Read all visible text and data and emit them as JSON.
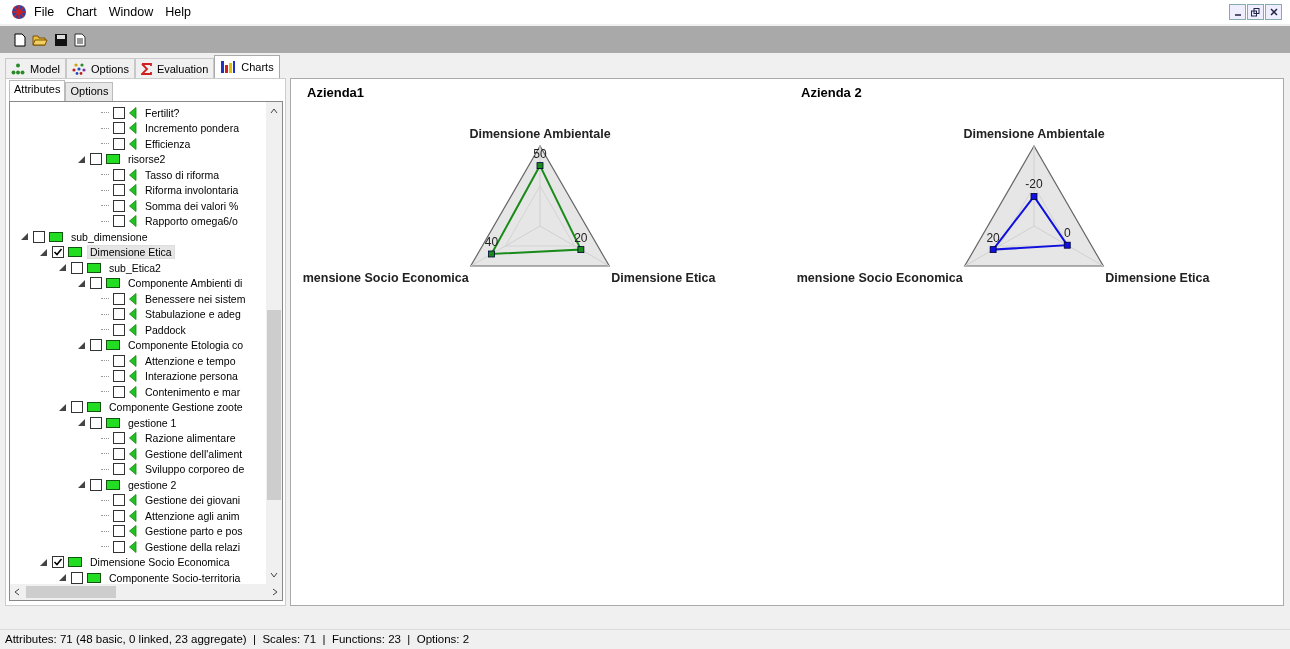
{
  "menu": [
    "File",
    "Chart",
    "Window",
    "Help"
  ],
  "tabs": [
    {
      "label": "Model",
      "selected": false
    },
    {
      "label": "Options",
      "selected": false
    },
    {
      "label": "Evaluation",
      "selected": false
    },
    {
      "label": "Charts",
      "selected": true
    }
  ],
  "subtabs": [
    {
      "label": "Attributes",
      "selected": true
    },
    {
      "label": "Options",
      "selected": false
    }
  ],
  "tree": [
    {
      "children": [
        {
          "children": [
            {
              "children": [
                {
                  "children": [
                    {
                      "label": "Fertilit?",
                      "kind": "basic",
                      "checked": false,
                      "selected": false
                    },
                    {
                      "label": "Incremento pondera",
                      "kind": "basic",
                      "checked": false,
                      "selected": false
                    },
                    {
                      "label": "Efficienza",
                      "kind": "basic",
                      "checked": false,
                      "selected": false
                    }
                  ]
                },
                {
                  "label": "risorse2",
                  "kind": "aggregate",
                  "checked": false,
                  "selected": false,
                  "expanded": true,
                  "children": [
                    {
                      "label": "Tasso di riforma",
                      "kind": "basic",
                      "checked": false,
                      "selected": false
                    },
                    {
                      "label": "Riforma involontaria",
                      "kind": "basic",
                      "checked": false,
                      "selected": false
                    },
                    {
                      "label": "Somma dei valori %",
                      "kind": "basic",
                      "checked": false,
                      "selected": false
                    },
                    {
                      "label": "Rapporto omega6/o",
                      "kind": "basic",
                      "checked": false,
                      "selected": false
                    }
                  ]
                }
              ]
            }
          ]
        }
      ]
    },
    {
      "label": "sub_dimensione",
      "kind": "aggregate",
      "checked": false,
      "selected": false,
      "expanded": true,
      "children": [
        {
          "label": "Dimensione Etica",
          "kind": "aggregate",
          "checked": true,
          "selected": true,
          "expanded": true,
          "children": [
            {
              "label": "sub_Etica2",
              "kind": "aggregate",
              "checked": false,
              "selected": false,
              "expanded": true,
              "children": [
                {
                  "label": "Componente Ambienti di",
                  "kind": "aggregate",
                  "checked": false,
                  "selected": false,
                  "expanded": true,
                  "children": [
                    {
                      "label": "Benessere nei sistem",
                      "kind": "basic",
                      "checked": false,
                      "selected": false
                    },
                    {
                      "label": "Stabulazione e adeg",
                      "kind": "basic",
                      "checked": false,
                      "selected": false
                    },
                    {
                      "label": "Paddock",
                      "kind": "basic",
                      "checked": false,
                      "selected": false
                    }
                  ]
                },
                {
                  "label": "Componente Etologia co",
                  "kind": "aggregate",
                  "checked": false,
                  "selected": false,
                  "expanded": true,
                  "children": [
                    {
                      "label": "Attenzione e tempo",
                      "kind": "basic",
                      "checked": false,
                      "selected": false
                    },
                    {
                      "label": "Interazione persona",
                      "kind": "basic",
                      "checked": false,
                      "selected": false
                    },
                    {
                      "label": "Contenimento e mar",
                      "kind": "basic",
                      "checked": false,
                      "selected": false
                    }
                  ]
                }
              ]
            },
            {
              "label": "Componente Gestione zoote",
              "kind": "aggregate",
              "checked": false,
              "selected": false,
              "expanded": true,
              "children": [
                {
                  "label": "gestione 1",
                  "kind": "aggregate",
                  "checked": false,
                  "selected": false,
                  "expanded": true,
                  "children": [
                    {
                      "label": "Razione alimentare",
                      "kind": "basic",
                      "checked": false,
                      "selected": false
                    },
                    {
                      "label": "Gestione dell'aliment",
                      "kind": "basic",
                      "checked": false,
                      "selected": false
                    },
                    {
                      "label": "Sviluppo corporeo de",
                      "kind": "basic",
                      "checked": false,
                      "selected": false
                    }
                  ]
                },
                {
                  "label": "gestione 2",
                  "kind": "aggregate",
                  "checked": false,
                  "selected": false,
                  "expanded": true,
                  "children": [
                    {
                      "label": "Gestione dei giovani",
                      "kind": "basic",
                      "checked": false,
                      "selected": false
                    },
                    {
                      "label": "Attenzione agli anim",
                      "kind": "basic",
                      "checked": false,
                      "selected": false
                    },
                    {
                      "label": "Gestione parto e pos",
                      "kind": "basic",
                      "checked": false,
                      "selected": false
                    },
                    {
                      "label": "Gestione della relazi",
                      "kind": "basic",
                      "checked": false,
                      "selected": false
                    }
                  ]
                }
              ]
            }
          ]
        },
        {
          "label": "Dimensione Socio Economica",
          "kind": "aggregate",
          "checked": true,
          "selected": false,
          "expanded": true,
          "children": [
            {
              "label": "Componente Socio-territoria",
              "kind": "aggregate",
              "checked": false,
              "selected": false,
              "expanded": true
            }
          ]
        }
      ]
    }
  ],
  "charts": [
    {
      "title": "Azienda1",
      "color": "#1a8a1a",
      "axes": [
        {
          "label": "Dimensione Ambientale",
          "value": "50"
        },
        {
          "label": "mensione Socio Economica",
          "value": "40"
        },
        {
          "label": "Dimensione Etica",
          "value": "20"
        }
      ]
    },
    {
      "title": "Azienda 2",
      "color": "#1010e0",
      "axes": [
        {
          "label": "Dimensione Ambientale",
          "value": "-20"
        },
        {
          "label": "mensione Socio Economica",
          "value": "20"
        },
        {
          "label": "Dimensione Etica",
          "value": "0"
        }
      ]
    }
  ],
  "status_bar": "Attributes: 71 (48 basic, 0 linked, 23 aggregate)  |  Scales: 71  |  Functions: 23  |  Options: 2"
}
